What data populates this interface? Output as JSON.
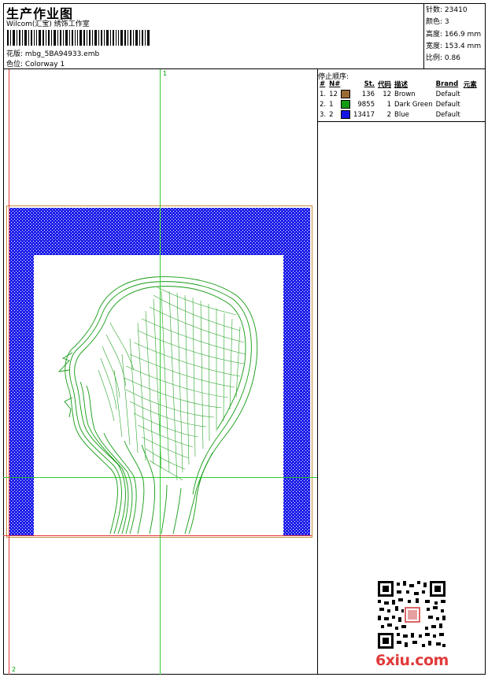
{
  "header": {
    "title": "生产作业图",
    "subtitle": "Wilcom(汇宝) 绣饰工作室",
    "design_label": "花版:",
    "design_value": "mbg_5BA94933.emb",
    "colorway_label": "色位:",
    "colorway_value": "Colorway 1"
  },
  "stats": {
    "stitches_label": "针数:",
    "stitches_value": "23410",
    "colors_label": "颜色:",
    "colors_value": "3",
    "height_label": "高度:",
    "height_value": "166.9 mm",
    "width_label": "宽度:",
    "width_value": "153.4 mm",
    "scale_label": "比例:",
    "scale_value": "0.86"
  },
  "stop_sequence": {
    "title": "停止顺序:",
    "columns": [
      "#",
      "N#",
      "St.",
      "代码",
      "描述",
      "Brand",
      "元素"
    ],
    "rows": [
      {
        "idx": "1.",
        "needle": "12",
        "color": "#9a6a36",
        "stitches": "136",
        "code": "12",
        "desc": "Brown",
        "brand": "Default"
      },
      {
        "idx": "2.",
        "needle": "1",
        "color": "#139b13",
        "stitches": "9855",
        "code": "1",
        "desc": "Dark Green",
        "brand": "Default"
      },
      {
        "idx": "3.",
        "needle": "2",
        "color": "#1414e6",
        "stitches": "13417",
        "code": "2",
        "desc": "Blue",
        "brand": "Default"
      }
    ]
  },
  "markers": {
    "top": "1",
    "bottom": "2"
  },
  "watermark": {
    "site": "6xiu.com"
  },
  "colors": {
    "frame_blue": "#1c1ce8",
    "head_green": "#139b13",
    "guide_green": "#33cc33",
    "guide_red": "#e23b3b",
    "hoop_brown": "#c88a3c"
  }
}
